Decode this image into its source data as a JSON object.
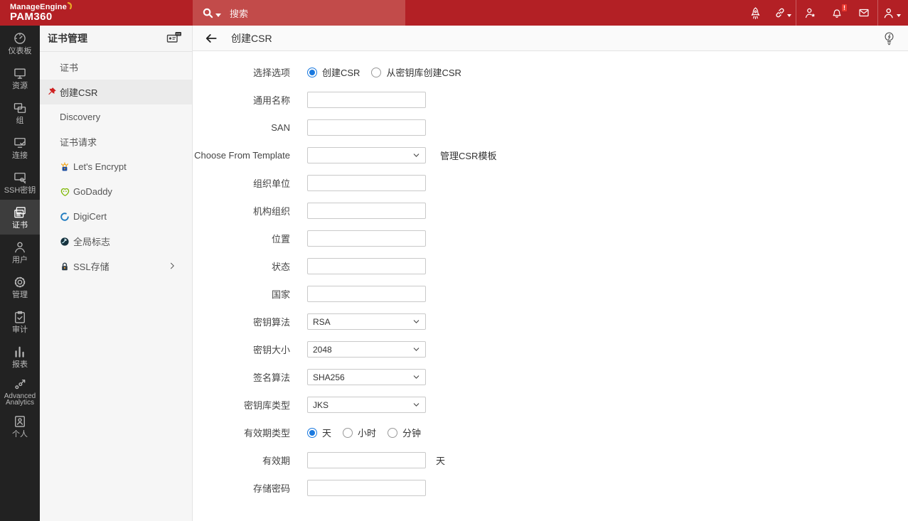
{
  "colors": {
    "topbar": "#b32025",
    "search_bar": "#c24b4a",
    "badge": "#ea3830",
    "accent_blue": "#1a79df",
    "rail_bg": "#222222",
    "submenu_bg": "#f6f6f6"
  },
  "brand": {
    "manage": "ManageEngine",
    "product": "PAM360"
  },
  "topbar": {
    "search_placeholder": "搜索",
    "notification_badge": "!",
    "icons": [
      "rocket-icon",
      "link-icon",
      "user-star-icon",
      "bell-icon",
      "mail-icon",
      "user-icon"
    ]
  },
  "sidebar": {
    "items": [
      {
        "label": "仪表板",
        "icon": "dashboard-icon",
        "selected": false
      },
      {
        "label": "资源",
        "icon": "resources-icon",
        "selected": false
      },
      {
        "label": "组",
        "icon": "groups-icon",
        "selected": false
      },
      {
        "label": "连接",
        "icon": "connections-icon",
        "selected": false
      },
      {
        "label": "SSH密钥",
        "icon": "ssh-keys-icon",
        "selected": false
      },
      {
        "label": "证书",
        "icon": "certificates-icon",
        "selected": true
      },
      {
        "label": "用户",
        "icon": "users-icon",
        "selected": false
      },
      {
        "label": "管理",
        "icon": "admin-icon",
        "selected": false
      },
      {
        "label": "审计",
        "icon": "audit-icon",
        "selected": false
      },
      {
        "label": "报表",
        "icon": "reports-icon",
        "selected": false
      },
      {
        "label": "Advanced Analytics",
        "line1": "Advanced",
        "line2": "Analytics",
        "icon": "analytics-icon",
        "selected": false
      },
      {
        "label": "个人",
        "icon": "personal-icon",
        "selected": false
      }
    ]
  },
  "submenu": {
    "title": "证书管理",
    "items": [
      {
        "label": "证书",
        "selected": false
      },
      {
        "label": "创建CSR",
        "selected": true,
        "icon": "pin-icon"
      },
      {
        "label": "Discovery",
        "selected": false
      },
      {
        "label": "证书请求",
        "selected": false
      },
      {
        "label": "Let's Encrypt",
        "selected": false,
        "icon": "lets-encrypt-icon"
      },
      {
        "label": "GoDaddy",
        "selected": false,
        "icon": "godaddy-icon"
      },
      {
        "label": "DigiCert",
        "selected": false,
        "icon": "digicert-icon"
      },
      {
        "label": "全局标志",
        "selected": false,
        "icon": "global-flag-icon"
      },
      {
        "label": "SSL存储",
        "selected": false,
        "icon": "ssl-store-icon",
        "has_submenu": true
      }
    ]
  },
  "header": {
    "title": "创建CSR"
  },
  "form": {
    "rows": [
      {
        "label": "选择选项",
        "type": "radio",
        "options": [
          {
            "label": "创建CSR",
            "checked": true
          },
          {
            "label": "从密钥库创建CSR",
            "checked": false
          }
        ]
      },
      {
        "label": "通用名称",
        "type": "text",
        "value": "",
        "placeholder": ""
      },
      {
        "label": "SAN",
        "type": "text",
        "value": "",
        "placeholder": ""
      },
      {
        "label": "Choose From Template",
        "type": "select",
        "value": "",
        "side_link": "管理CSR模板"
      },
      {
        "label": "组织单位",
        "type": "text",
        "value": "",
        "placeholder": ""
      },
      {
        "label": "机构组织",
        "type": "text",
        "value": "",
        "placeholder": ""
      },
      {
        "label": "位置",
        "type": "text",
        "value": "",
        "placeholder": ""
      },
      {
        "label": "状态",
        "type": "text",
        "value": "",
        "placeholder": ""
      },
      {
        "label": "国家",
        "type": "text",
        "value": "",
        "placeholder": ""
      },
      {
        "label": "密钥算法",
        "type": "select",
        "value": "RSA"
      },
      {
        "label": "密钥大小",
        "type": "select",
        "value": "2048"
      },
      {
        "label": "签名算法",
        "type": "select",
        "value": "SHA256"
      },
      {
        "label": "密钥库类型",
        "type": "select",
        "value": "JKS"
      },
      {
        "label": "有效期类型",
        "type": "radio",
        "options": [
          {
            "label": "天",
            "checked": true
          },
          {
            "label": "小时",
            "checked": false
          },
          {
            "label": "分钟",
            "checked": false
          }
        ]
      },
      {
        "label": "有效期",
        "type": "text",
        "value": "",
        "placeholder": "",
        "suffix": "天"
      },
      {
        "label": "存储密码",
        "type": "text",
        "value": "",
        "placeholder": ""
      }
    ]
  }
}
